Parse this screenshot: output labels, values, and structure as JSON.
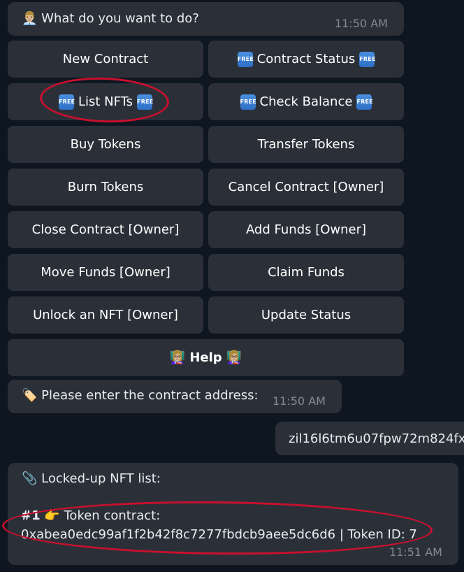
{
  "prompt_message": {
    "text": "What do you want to do?",
    "time": "11:50 AM",
    "icon": "person-at-desk-icon"
  },
  "keyboard": {
    "new_contract": "New Contract",
    "contract_status": "Contract Status",
    "list_nfts": "List NFTs",
    "check_balance": "Check Balance",
    "buy_tokens": "Buy Tokens",
    "transfer_tokens": "Transfer Tokens",
    "burn_tokens": "Burn Tokens",
    "cancel_contract": "Cancel Contract [Owner]",
    "close_contract": "Close Contract [Owner]",
    "add_funds": "Add Funds [Owner]",
    "move_funds": "Move Funds [Owner]",
    "claim_funds": "Claim Funds",
    "unlock_nft": "Unlock an NFT [Owner]",
    "update_status": "Update Status",
    "help": "Help",
    "free_badge": "FREE"
  },
  "address_prompt": {
    "text": "Please enter the contract address:",
    "time": "11:50 AM",
    "icon": "label-tag-icon"
  },
  "user_message": {
    "text": "zil16l6tm6u07fpw72m824fx"
  },
  "nft_list_message": {
    "header": "Locked-up NFT list:",
    "item_number": "#1",
    "item_label": "Token contract:",
    "item_detail": "0xabea0edc99af1f2b42f8c7277fbdcb9aee5dc6d6 | Token ID: 7",
    "time": "11:51 AM",
    "icon": "paperclip-icon"
  },
  "colors": {
    "background": "#0e1621",
    "bubble": "#2b3038",
    "annotation": "#c8102e",
    "free_badge": "#3a7fd5"
  }
}
